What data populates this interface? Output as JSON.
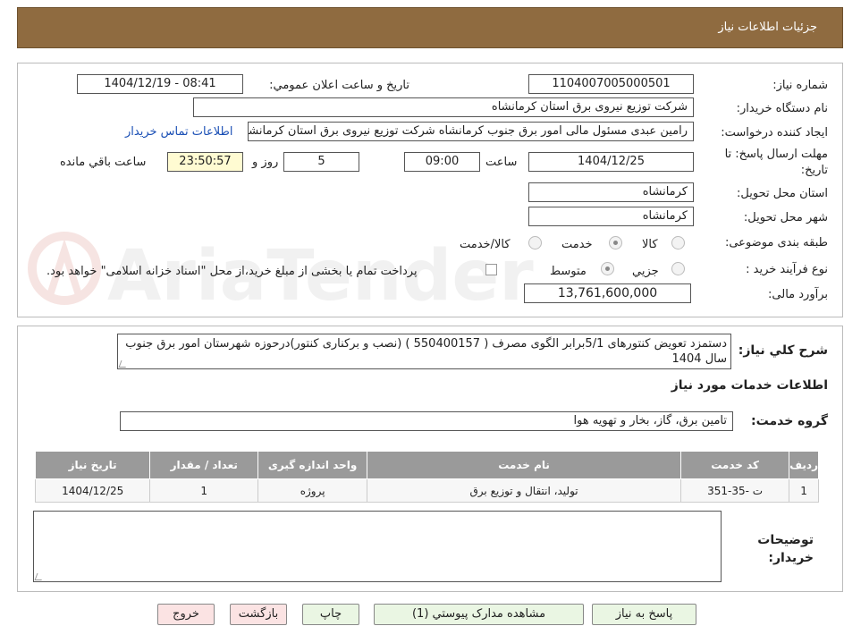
{
  "header": {
    "title": "جزئيات اطلاعات نياز"
  },
  "labels": {
    "need_number": "شماره نياز:",
    "announce_datetime": "تاريخ و ساعت اعلان عمومي:",
    "buyer_org": "نام دستگاه خريدار:",
    "requester": "ايجاد کننده درخواست:",
    "deadline": "مهلت ارسال پاسخ: تا تاريخ:",
    "time": "ساعت",
    "day_and": "روز و",
    "remaining": "ساعت باقي مانده",
    "province": "استان محل تحويل:",
    "city": "شهر محل تحويل:",
    "category": "طبقه بندی موضوعی:",
    "process": "نوع فرآيند خريد :",
    "budget": "برآورد مالی:",
    "description": "شرح کلي نياز:",
    "services_title": "اطلاعات خدمات مورد نياز",
    "service_group": "گروه خدمت:",
    "buyer_notes": "توضيحات خريدار:"
  },
  "values": {
    "need_number": "1104007005000501",
    "announce_datetime": "1404/12/19 - 08:41",
    "buyer_org": "شرکت توزيع نيروی برق استان کرمانشاه",
    "requester": "رامين عبدی مسئول مالی امور برق جنوب کرمانشاه شرکت توزيع نيروی برق استان کرمانشاه",
    "contact_link": "اطلاعات تماس خريدار",
    "deadline_date": "1404/12/25",
    "deadline_time": "09:00",
    "days": "5",
    "remaining_time": "23:50:57",
    "province": "کرمانشاه",
    "city": "کرمانشاه",
    "budget": "13,761,600,000",
    "description": "دستمزد تعويض کنتورهای 5/1برابر الگوی مصرف  ( 550400157 ) (نصب و برکناری کنتور)درحوزه شهرستان امور برق جنوب  سال 1404",
    "service_group": "تامين برق، گاز، بخار و تهويه هوا"
  },
  "category_options": [
    {
      "label": "کالا",
      "checked": false
    },
    {
      "label": "خدمت",
      "checked": true
    },
    {
      "label": "کالا/خدمت",
      "checked": false
    }
  ],
  "process_options": [
    {
      "label": "جزيي",
      "checked": false
    },
    {
      "label": "متوسط",
      "checked": true
    }
  ],
  "payment_note": "پرداخت تمام يا بخشی از مبلغ خريد،از محل \"اسناد خزانه اسلامی\" خواهد بود.",
  "table": {
    "headers": [
      "رديف",
      "کد خدمت",
      "نام خدمت",
      "واحد اندازه گيری",
      "تعداد / مقدار",
      "تاريخ نياز"
    ],
    "rows": [
      [
        "1",
        "ت -35-351",
        "توليد، انتقال و توزيع برق",
        "پروژه",
        "1",
        "1404/12/25"
      ]
    ]
  },
  "buttons": {
    "reply": "پاسخ به نياز",
    "attachments": "مشاهده مدارک پيوستي (1)",
    "print": "چاپ",
    "back": "بازگشت",
    "exit": "خروج"
  },
  "watermark": "AriaTender.net"
}
